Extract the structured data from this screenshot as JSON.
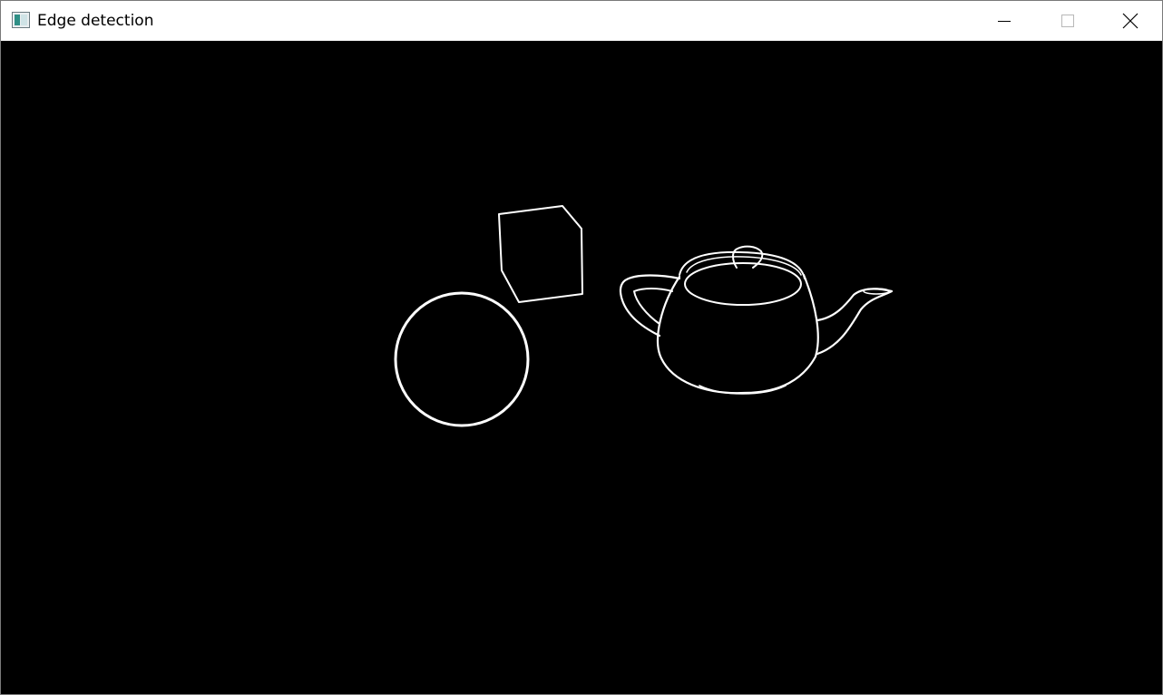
{
  "window": {
    "title": "Edge detection",
    "controls": {
      "minimize": "minimize-icon",
      "maximize": "maximize-icon",
      "close": "close-icon"
    }
  },
  "viewport": {
    "background_color": "#000000",
    "edge_color": "#ffffff",
    "objects": [
      "sphere",
      "cube",
      "teapot"
    ]
  }
}
